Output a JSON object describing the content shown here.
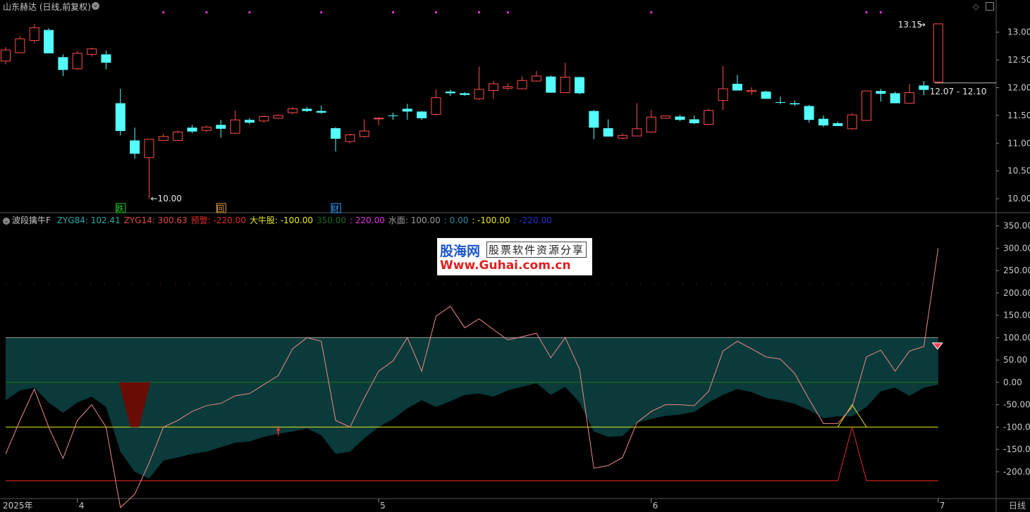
{
  "header": {
    "title": "山东赫达 (日线,前复权)",
    "right_glyph": "◇",
    "period_label": "日线"
  },
  "indicator_bar": {
    "name": "波段擒牛F",
    "items": [
      {
        "text": "ZYG84: 102.41",
        "color": "#2aa7a7"
      },
      {
        "text": "ZYG14: 300.63",
        "color": "#e04848"
      },
      {
        "text": "预警: -220.00",
        "color": "#e02a2a"
      },
      {
        "text": "大牛股: -100.00",
        "color": "#e8e820"
      },
      {
        "text": "350.00",
        "color": "#1c6b1c"
      },
      {
        "text": ": 220.00",
        "color": "#e030e0"
      },
      {
        "text": "水面: 100.00",
        "color": "#9a9a9a"
      },
      {
        "text": ": 0.00",
        "color": "#2a8aa7"
      },
      {
        "text": ": -100.00",
        "color": "#e8e820"
      },
      {
        "text": ": -220.00",
        "color": "#2233cc"
      }
    ]
  },
  "watermark": {
    "line1": "股海网",
    "line2": "股票软件资源分享",
    "line3": "Www.Guhai.com.cn"
  },
  "colors": {
    "up": "#ff4d4d",
    "down": "#54ffff",
    "zyg84_fill": "#0a3a3a",
    "zyg14": "#f08a8a",
    "warn": "#e02a2a",
    "bull": "#e8e820",
    "water": "#9a9a9a",
    "zero": "#1b7a1b"
  },
  "chart_data": [
    {
      "type": "candlestick",
      "title": "山东赫达 (日线,前复权)",
      "ylim": [
        9.9,
        13.25
      ],
      "y_ticks": [
        10.0,
        10.5,
        11.0,
        11.5,
        12.0,
        12.5,
        13.0
      ],
      "y_tick_labels": [
        "10.00",
        "10.50",
        "11.00",
        "11.50",
        "12.00",
        "12.50",
        "13.00"
      ],
      "annotations": {
        "low_label": "10.00",
        "high_label": "13.15",
        "last_range_label": "12.07 - 12.10"
      },
      "signal_labels": [
        {
          "index": 8,
          "text": "跌",
          "color": "#22cc22"
        },
        {
          "index": 15,
          "text": "回",
          "color": "#e6a23c"
        },
        {
          "index": 23,
          "text": "财",
          "color": "#3aa0ff"
        }
      ],
      "marker_indices": [
        11,
        14,
        17,
        22,
        27,
        30,
        33,
        35,
        45,
        60,
        61
      ],
      "candles": [
        {
          "o": 12.48,
          "h": 12.73,
          "l": 12.42,
          "c": 12.68
        },
        {
          "o": 12.63,
          "h": 12.93,
          "l": 12.62,
          "c": 12.88
        },
        {
          "o": 12.85,
          "h": 13.15,
          "l": 12.8,
          "c": 13.08
        },
        {
          "o": 13.04,
          "h": 13.07,
          "l": 12.62,
          "c": 12.62
        },
        {
          "o": 12.55,
          "h": 12.6,
          "l": 12.21,
          "c": 12.32
        },
        {
          "o": 12.34,
          "h": 12.66,
          "l": 12.32,
          "c": 12.62
        },
        {
          "o": 12.6,
          "h": 12.72,
          "l": 12.56,
          "c": 12.7
        },
        {
          "o": 12.6,
          "h": 12.67,
          "l": 12.33,
          "c": 12.45
        },
        {
          "o": 11.72,
          "h": 11.98,
          "l": 11.14,
          "c": 11.22
        },
        {
          "o": 11.05,
          "h": 11.28,
          "l": 10.72,
          "c": 10.81
        },
        {
          "o": 10.74,
          "h": 10.95,
          "l": 10.0,
          "c": 11.07
        },
        {
          "o": 11.05,
          "h": 11.17,
          "l": 11.04,
          "c": 11.12
        },
        {
          "o": 11.05,
          "h": 11.23,
          "l": 11.04,
          "c": 11.2
        },
        {
          "o": 11.28,
          "h": 11.33,
          "l": 11.18,
          "c": 11.21
        },
        {
          "o": 11.23,
          "h": 11.32,
          "l": 11.2,
          "c": 11.29
        },
        {
          "o": 11.33,
          "h": 11.42,
          "l": 11.1,
          "c": 11.26
        },
        {
          "o": 11.18,
          "h": 11.59,
          "l": 11.17,
          "c": 11.42
        },
        {
          "o": 11.42,
          "h": 11.45,
          "l": 11.34,
          "c": 11.37
        },
        {
          "o": 11.4,
          "h": 11.5,
          "l": 11.37,
          "c": 11.48
        },
        {
          "o": 11.45,
          "h": 11.52,
          "l": 11.45,
          "c": 11.5
        },
        {
          "o": 11.55,
          "h": 11.65,
          "l": 11.52,
          "c": 11.62
        },
        {
          "o": 11.62,
          "h": 11.65,
          "l": 11.56,
          "c": 11.58
        },
        {
          "o": 11.58,
          "h": 11.68,
          "l": 11.53,
          "c": 11.55
        },
        {
          "o": 11.27,
          "h": 11.29,
          "l": 10.85,
          "c": 11.08
        },
        {
          "o": 11.03,
          "h": 11.17,
          "l": 11.0,
          "c": 11.15
        },
        {
          "o": 11.12,
          "h": 11.43,
          "l": 11.1,
          "c": 11.22
        },
        {
          "o": 11.44,
          "h": 11.47,
          "l": 11.32,
          "c": 11.45
        },
        {
          "o": 11.5,
          "h": 11.55,
          "l": 11.42,
          "c": 11.49
        },
        {
          "o": 11.62,
          "h": 11.71,
          "l": 11.42,
          "c": 11.57
        },
        {
          "o": 11.57,
          "h": 11.58,
          "l": 11.42,
          "c": 11.45
        },
        {
          "o": 11.52,
          "h": 11.97,
          "l": 11.5,
          "c": 11.82
        },
        {
          "o": 11.93,
          "h": 11.97,
          "l": 11.85,
          "c": 11.9
        },
        {
          "o": 11.9,
          "h": 11.92,
          "l": 11.85,
          "c": 11.87
        },
        {
          "o": 11.8,
          "h": 12.38,
          "l": 11.78,
          "c": 11.97
        },
        {
          "o": 11.95,
          "h": 12.12,
          "l": 11.8,
          "c": 12.07
        },
        {
          "o": 11.99,
          "h": 12.08,
          "l": 11.95,
          "c": 12.02
        },
        {
          "o": 11.98,
          "h": 12.2,
          "l": 11.97,
          "c": 12.13
        },
        {
          "o": 12.12,
          "h": 12.3,
          "l": 12.11,
          "c": 12.21
        },
        {
          "o": 12.2,
          "h": 12.22,
          "l": 11.91,
          "c": 11.91
        },
        {
          "o": 11.91,
          "h": 12.45,
          "l": 11.9,
          "c": 12.19
        },
        {
          "o": 12.19,
          "h": 12.2,
          "l": 11.88,
          "c": 11.9
        },
        {
          "o": 11.58,
          "h": 11.6,
          "l": 11.07,
          "c": 11.28
        },
        {
          "o": 11.27,
          "h": 11.43,
          "l": 11.12,
          "c": 11.12
        },
        {
          "o": 11.09,
          "h": 11.18,
          "l": 11.07,
          "c": 11.14
        },
        {
          "o": 11.13,
          "h": 11.72,
          "l": 11.13,
          "c": 11.26
        },
        {
          "o": 11.2,
          "h": 11.6,
          "l": 11.19,
          "c": 11.47
        },
        {
          "o": 11.45,
          "h": 11.5,
          "l": 11.44,
          "c": 11.49
        },
        {
          "o": 11.48,
          "h": 11.51,
          "l": 11.4,
          "c": 11.42
        },
        {
          "o": 11.43,
          "h": 11.5,
          "l": 11.34,
          "c": 11.36
        },
        {
          "o": 11.34,
          "h": 11.62,
          "l": 11.33,
          "c": 11.59
        },
        {
          "o": 11.77,
          "h": 12.39,
          "l": 11.6,
          "c": 11.98
        },
        {
          "o": 12.07,
          "h": 12.23,
          "l": 11.95,
          "c": 11.95
        },
        {
          "o": 11.93,
          "h": 12.01,
          "l": 11.87,
          "c": 11.95
        },
        {
          "o": 11.93,
          "h": 11.95,
          "l": 11.8,
          "c": 11.8
        },
        {
          "o": 11.74,
          "h": 11.84,
          "l": 11.7,
          "c": 11.73
        },
        {
          "o": 11.72,
          "h": 11.77,
          "l": 11.67,
          "c": 11.7
        },
        {
          "o": 11.67,
          "h": 11.69,
          "l": 11.37,
          "c": 11.42
        },
        {
          "o": 11.44,
          "h": 11.5,
          "l": 11.29,
          "c": 11.32
        },
        {
          "o": 11.36,
          "h": 11.39,
          "l": 11.31,
          "c": 11.31
        },
        {
          "o": 11.26,
          "h": 11.54,
          "l": 11.24,
          "c": 11.51
        },
        {
          "o": 11.41,
          "h": 11.95,
          "l": 11.4,
          "c": 11.94
        },
        {
          "o": 11.94,
          "h": 11.98,
          "l": 11.75,
          "c": 11.89
        },
        {
          "o": 11.9,
          "h": 11.93,
          "l": 11.72,
          "c": 11.72
        },
        {
          "o": 11.72,
          "h": 12.07,
          "l": 11.72,
          "c": 11.91
        },
        {
          "o": 12.04,
          "h": 12.12,
          "l": 11.86,
          "c": 11.96
        },
        {
          "o": 12.1,
          "h": 13.15,
          "l": 12.07,
          "c": 13.15
        }
      ]
    },
    {
      "type": "line",
      "title": "波段擒牛F",
      "ylim": [
        -260,
        370
      ],
      "y_ticks": [
        350,
        300,
        250,
        200,
        150,
        100,
        50,
        0,
        -50,
        -100,
        -150,
        -200
      ],
      "y_tick_labels": [
        "350.00",
        "300.00",
        "250.00",
        "200.00",
        "150.00",
        "100.00",
        "50.00",
        "0.00",
        "-50.00",
        "-100.00",
        "-150.00",
        "-200.00"
      ],
      "x_labels": [
        {
          "index": 0,
          "text": "2025年"
        },
        {
          "index": 5,
          "text": "4"
        },
        {
          "index": 26,
          "text": "5"
        },
        {
          "index": 45,
          "text": "6"
        },
        {
          "index": 65,
          "text": "7"
        }
      ],
      "reference_lines": {
        "water": 100,
        "zero": 0,
        "bull": -100,
        "warn": -220
      },
      "dotted_levels": [
        220
      ],
      "series": [
        {
          "name": "ZYG84",
          "values": [
            -40,
            -18,
            -12,
            -45,
            -68,
            -45,
            -32,
            -55,
            -155,
            -200,
            -215,
            -175,
            -168,
            -160,
            -155,
            -145,
            -135,
            -132,
            -122,
            -115,
            -110,
            -103,
            -118,
            -160,
            -155,
            -125,
            -100,
            -82,
            -58,
            -40,
            -55,
            -42,
            -28,
            -25,
            -32,
            -18,
            -10,
            -2,
            -28,
            -10,
            -45,
            -110,
            -122,
            -120,
            -90,
            -82,
            -75,
            -72,
            -66,
            -45,
            -28,
            -15,
            -22,
            -35,
            -40,
            -48,
            -62,
            -80,
            -76,
            -76,
            -55,
            -20,
            -12,
            -30,
            -12,
            -5,
            102
          ]
        },
        {
          "name": "ZYG14",
          "values": [
            -160,
            -85,
            -15,
            -100,
            -170,
            -85,
            -50,
            -100,
            -280,
            -250,
            -180,
            -100,
            -85,
            -65,
            -52,
            -47,
            -30,
            -25,
            -5,
            15,
            75,
            100,
            92,
            -85,
            -100,
            -35,
            25,
            48,
            100,
            25,
            148,
            170,
            122,
            142,
            118,
            95,
            102,
            110,
            55,
            100,
            30,
            -192,
            -186,
            -168,
            -90,
            -65,
            -50,
            -50,
            -52,
            -20,
            70,
            92,
            75,
            57,
            52,
            20,
            -38,
            -92,
            -92,
            -55,
            57,
            72,
            25,
            70,
            80,
            300
          ]
        }
      ],
      "signals": [
        {
          "type": "warn_block",
          "indices": [
            8,
            10
          ]
        },
        {
          "type": "bull_arrow",
          "index": 19
        },
        {
          "type": "yellow_peak",
          "indices": [
            58,
            60
          ],
          "peak": -50
        },
        {
          "type": "red_spike",
          "indices": [
            58,
            60
          ],
          "peak": -100
        },
        {
          "type": "gem",
          "index": 65
        }
      ]
    }
  ]
}
